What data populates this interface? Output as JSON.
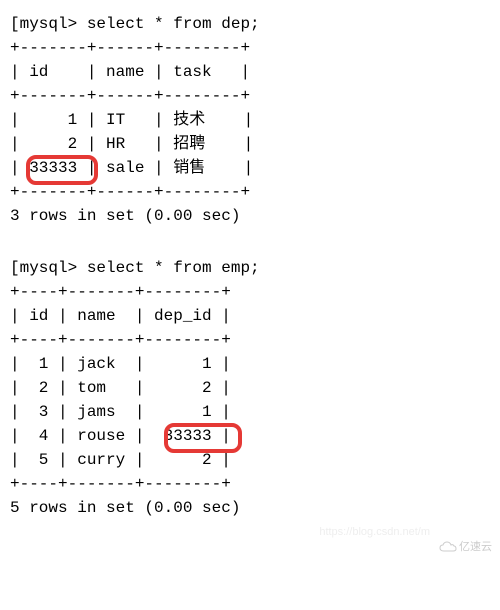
{
  "query1": {
    "prompt": "[mysql> select * from dep;",
    "border_top": "+-------+------+--------+",
    "header": "| id    | name | task   |",
    "rows": [
      "|     1 | IT   | 技术    |",
      "|     2 | HR   | 招聘    |",
      "| 33333 | sale | 销售    |"
    ],
    "footer": "3 rows in set (0.00 sec)",
    "highlight_value": "33333"
  },
  "query2": {
    "prompt": "[mysql> select * from emp;",
    "border_top": "+----+-------+--------+",
    "header": "| id | name  | dep_id |",
    "rows": [
      "|  1 | jack  |      1 |",
      "|  2 | tom   |      2 |",
      "|  3 | jams  |      1 |",
      "|  4 | rouse |  33333 |",
      "|  5 | curry |      2 |"
    ],
    "footer": "5 rows in set (0.00 sec)",
    "highlight_value": "33333"
  },
  "watermark_brand": "亿速云",
  "watermark_url": "https://blog.csdn.net/m"
}
